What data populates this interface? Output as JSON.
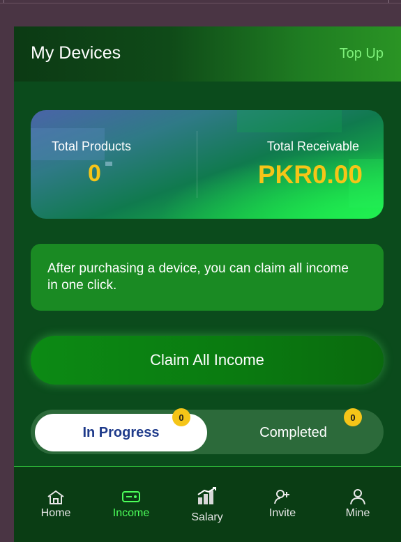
{
  "header": {
    "title": "My Devices",
    "topup_label": "Top Up"
  },
  "stats": {
    "total_products_label": "Total Products",
    "total_products_value": "0",
    "total_receivable_label": "Total Receivable",
    "total_receivable_value": "PKR0.00"
  },
  "info": {
    "text": "After purchasing a device, you can claim all income in one click."
  },
  "claim_button": {
    "label": "Claim All Income"
  },
  "tabs": [
    {
      "label": "In Progress",
      "badge": "0",
      "active": true
    },
    {
      "label": "Completed",
      "badge": "0",
      "active": false
    }
  ],
  "nav": {
    "items": [
      {
        "label": "Home",
        "icon": "home-icon"
      },
      {
        "label": "Income",
        "icon": "income-icon",
        "active": true
      },
      {
        "label": "Salary",
        "icon": "salary-icon"
      },
      {
        "label": "Invite",
        "icon": "invite-icon"
      },
      {
        "label": "Mine",
        "icon": "user-icon"
      }
    ]
  },
  "colors": {
    "accent_green": "#4cff5a",
    "value_yellow": "#f5c518",
    "app_background": "#0b4b1c",
    "tab_active_text": "#1e3a8a"
  }
}
